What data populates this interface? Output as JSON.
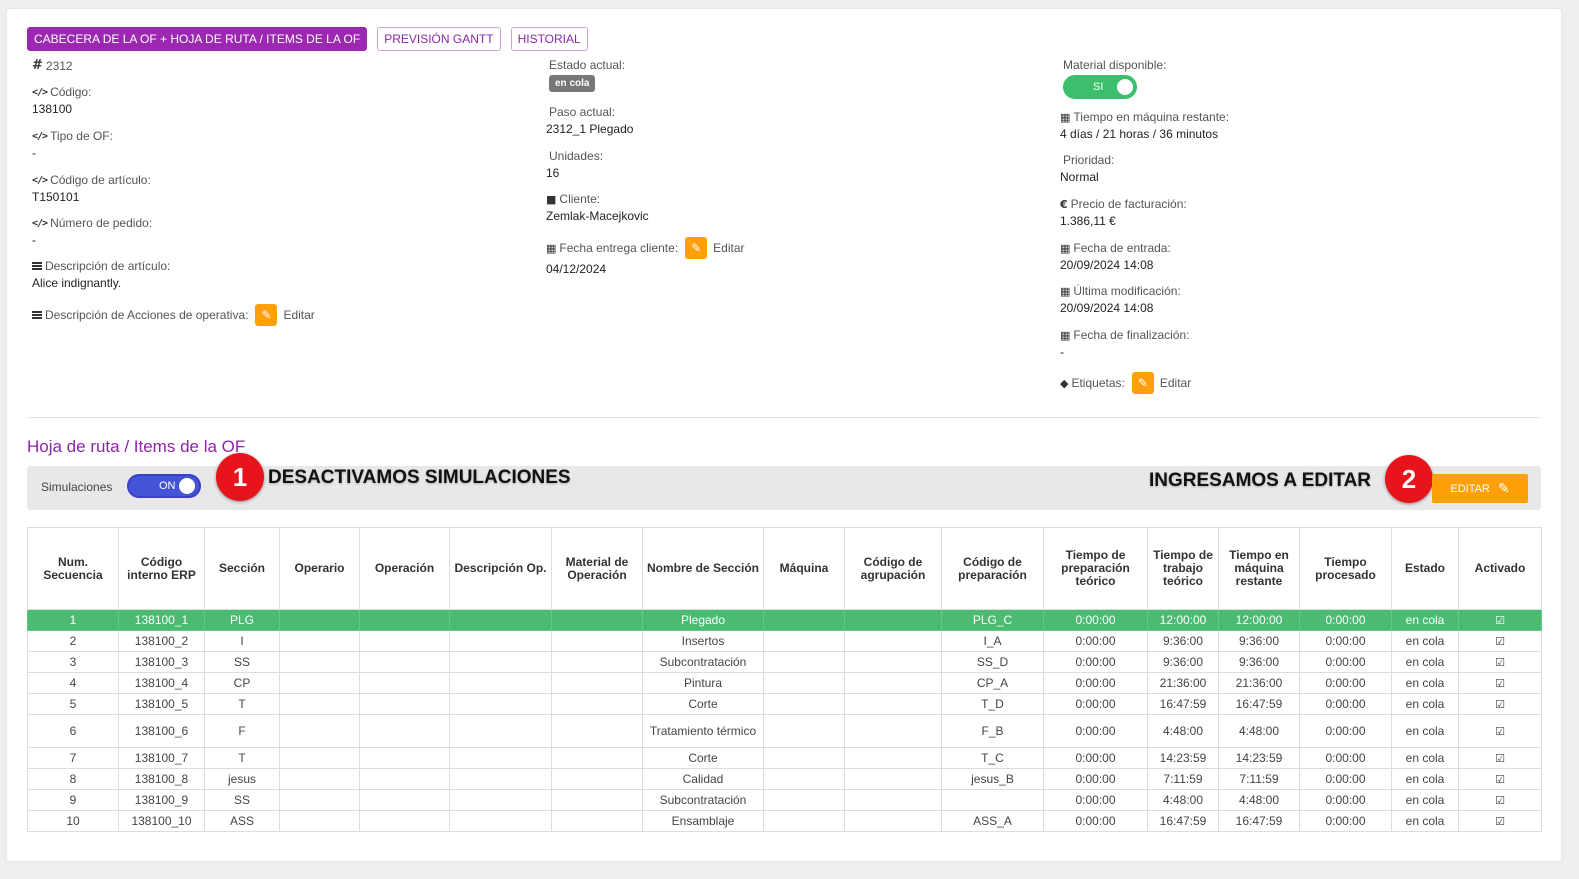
{
  "tabs": [
    {
      "label": "CABECERA DE LA OF + HOJA DE RUTA / ITEMS DE LA OF",
      "active": true
    },
    {
      "label": "PREVISIÓN GANTT",
      "active": false
    },
    {
      "label": "HISTORIAL",
      "active": false
    }
  ],
  "col1": {
    "of_number": "2312",
    "codigo": {
      "label": "Código:",
      "value": "138100"
    },
    "tipo_of": {
      "label": "Tipo de OF:",
      "value": "-"
    },
    "codigo_articulo": {
      "label": "Código de artículo:",
      "value": "T150101"
    },
    "numero_pedido": {
      "label": "Número de pedido:",
      "value": "-"
    },
    "descripcion_articulo": {
      "label": "Descripción de artículo:",
      "value": "Alice indignantly."
    },
    "descripcion_acciones": {
      "label": "Descripción de Acciones de operativa:",
      "edit": "Editar"
    }
  },
  "col2": {
    "estado_actual": {
      "label": "Estado actual:",
      "value": "en cola"
    },
    "paso_actual": {
      "label": "Paso actual:",
      "value": "2312_1 Plegado"
    },
    "unidades": {
      "label": "Unidades:",
      "value": "16"
    },
    "cliente": {
      "label": "Cliente:",
      "value": "Zemlak-Macejkovic"
    },
    "fecha_entrega": {
      "label": "Fecha entrega cliente:",
      "edit": "Editar",
      "value": "04/12/2024"
    }
  },
  "col3": {
    "material_disponible": {
      "label": "Material disponible:",
      "toggle": "SI"
    },
    "tiempo_maquina": {
      "label": "Tiempo en máquina restante:",
      "value": "4 días / 21 horas / 36 minutos"
    },
    "prioridad": {
      "label": "Prioridad:",
      "value": "Normal"
    },
    "precio": {
      "label": "Precio de facturación:",
      "value": "1.386,11 €"
    },
    "fecha_entrada": {
      "label": "Fecha de entrada:",
      "value": "20/09/2024 14:08"
    },
    "ultima_modificacion": {
      "label": "Última modificación:",
      "value": "20/09/2024 14:08"
    },
    "fecha_finalizacion": {
      "label": "Fecha de finalización:",
      "value": "-"
    },
    "etiquetas": {
      "label": "Etiquetas:",
      "edit": "Editar"
    }
  },
  "route": {
    "title": "Hoja de ruta / Items de la OF",
    "sim_label": "Simulaciones",
    "sim_toggle": "ON",
    "annot1_num": "1",
    "annot1_text": "DESACTIVAMOS SIMULACIONES",
    "annot2_num": "2",
    "annot2_text": "INGRESAMOS A EDITAR",
    "edit_label": "EDITAR"
  },
  "table": {
    "headers": [
      "Num. Secuencia",
      "Código interno ERP",
      "Sección",
      "Operario",
      "Operación",
      "Descripción Op.",
      "Material de Operación",
      "Nombre de Sección",
      "Máquina",
      "Código de agrupación",
      "Código de preparación",
      "Tiempo de preparación teórico",
      "Tiempo de trabajo teórico",
      "Tiempo en máquina restante",
      "Tiempo procesado",
      "Estado",
      "Activado"
    ],
    "rows": [
      [
        "1",
        "138100_1",
        "PLG",
        "",
        "",
        "",
        "",
        "Plegado",
        "",
        "",
        "PLG_C",
        "0:00:00",
        "12:00:00",
        "12:00:00",
        "0:00:00",
        "en cola"
      ],
      [
        "2",
        "138100_2",
        "I",
        "",
        "",
        "",
        "",
        "Insertos",
        "",
        "",
        "I_A",
        "0:00:00",
        "9:36:00",
        "9:36:00",
        "0:00:00",
        "en cola"
      ],
      [
        "3",
        "138100_3",
        "SS",
        "",
        "",
        "",
        "",
        "Subcontratación",
        "",
        "",
        "SS_D",
        "0:00:00",
        "9:36:00",
        "9:36:00",
        "0:00:00",
        "en cola"
      ],
      [
        "4",
        "138100_4",
        "CP",
        "",
        "",
        "",
        "",
        "Pintura",
        "",
        "",
        "CP_A",
        "0:00:00",
        "21:36:00",
        "21:36:00",
        "0:00:00",
        "en cola"
      ],
      [
        "5",
        "138100_5",
        "T",
        "",
        "",
        "",
        "",
        "Corte",
        "",
        "",
        "T_D",
        "0:00:00",
        "16:47:59",
        "16:47:59",
        "0:00:00",
        "en cola"
      ],
      [
        "6",
        "138100_6",
        "F",
        "",
        "",
        "",
        "",
        "Tratamiento térmico",
        "",
        "",
        "F_B",
        "0:00:00",
        "4:48:00",
        "4:48:00",
        "0:00:00",
        "en cola"
      ],
      [
        "7",
        "138100_7",
        "T",
        "",
        "",
        "",
        "",
        "Corte",
        "",
        "",
        "T_C",
        "0:00:00",
        "14:23:59",
        "14:23:59",
        "0:00:00",
        "en cola"
      ],
      [
        "8",
        "138100_8",
        "jesus",
        "",
        "",
        "",
        "",
        "Calidad",
        "",
        "",
        "jesus_B",
        "0:00:00",
        "7:11:59",
        "7:11:59",
        "0:00:00",
        "en cola"
      ],
      [
        "9",
        "138100_9",
        "SS",
        "",
        "",
        "",
        "",
        "Subcontratación",
        "",
        "",
        "",
        "0:00:00",
        "4:48:00",
        "4:48:00",
        "0:00:00",
        "en cola"
      ],
      [
        "10",
        "138100_10",
        "ASS",
        "",
        "",
        "",
        "",
        "Ensamblaje",
        "",
        "",
        "ASS_A",
        "0:00:00",
        "16:47:59",
        "16:47:59",
        "0:00:00",
        "en cola"
      ]
    ]
  },
  "colors": {
    "accent": "#9c27b0",
    "selected_row": "#4cbb72",
    "edit": "#ff9f0a",
    "toggle_on_green": "#3cbf6c",
    "toggle_on_blue": "#4354d6",
    "marker": "#e8141c"
  }
}
